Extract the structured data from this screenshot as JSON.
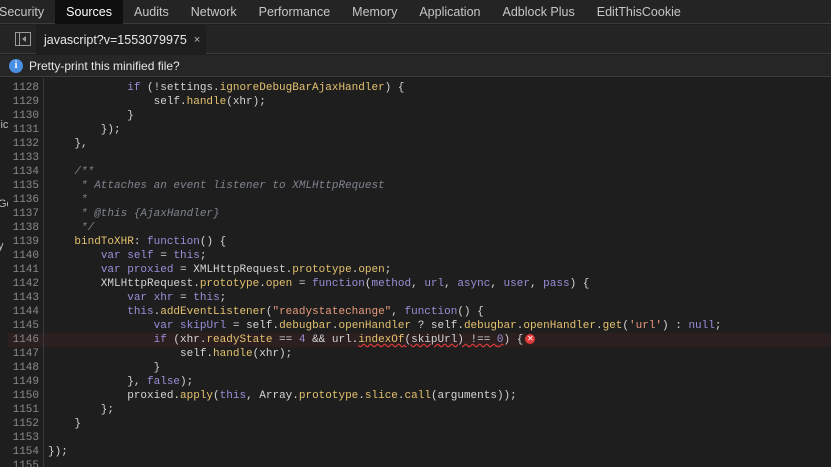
{
  "devtools_tabs": [
    "Security",
    "Sources",
    "Audits",
    "Network",
    "Performance",
    "Memory",
    "Application",
    "Adblock Plus",
    "EditThisCookie"
  ],
  "active_tab": "Sources",
  "file_tab": {
    "name": "javascript?v=1553079975",
    "close": "×"
  },
  "infobar": {
    "message": "Pretty-print this minified file?"
  },
  "left_strip": [
    "lic",
    "Go",
    "y"
  ],
  "error_line": 1146,
  "code_lines": [
    {
      "n": 1128,
      "html": "            <span class='kw'>if</span> (!settings.<span class='fn'>ignoreDebugBarAjaxHandler</span>) {"
    },
    {
      "n": 1129,
      "html": "                self.<span class='fn'>handle</span>(xhr);"
    },
    {
      "n": 1130,
      "html": "            }"
    },
    {
      "n": 1131,
      "html": "        });"
    },
    {
      "n": 1132,
      "html": "    },"
    },
    {
      "n": 1133,
      "html": ""
    },
    {
      "n": 1134,
      "html": "    <span class='cmt'>/**</span>"
    },
    {
      "n": 1135,
      "html": "<span class='cmt'>     * Attaches an event listener to XMLHttpRequest</span>"
    },
    {
      "n": 1136,
      "html": "<span class='cmt'>     *</span>"
    },
    {
      "n": 1137,
      "html": "<span class='cmt'>     * @this {AjaxHandler}</span>"
    },
    {
      "n": 1138,
      "html": "<span class='cmt'>     */</span>"
    },
    {
      "n": 1139,
      "html": "    <span class='fn'>bindToXHR</span>: <span class='kw'>function</span>() {"
    },
    {
      "n": 1140,
      "html": "        <span class='kw'>var</span> <span class='param'>self</span> = <span class='kw'>this</span>;"
    },
    {
      "n": 1141,
      "html": "        <span class='kw'>var</span> <span class='param'>proxied</span> = XMLHttpRequest.<span class='fn'>prototype</span>.<span class='fn'>open</span>;"
    },
    {
      "n": 1142,
      "html": "        XMLHttpRequest.<span class='fn'>prototype</span>.<span class='fn'>open</span> = <span class='kw'>function</span>(<span class='param'>method</span>, <span class='param'>url</span>, <span class='param'>async</span>, <span class='param'>user</span>, <span class='param'>pass</span>) {"
    },
    {
      "n": 1143,
      "html": "            <span class='kw'>var</span> <span class='param'>xhr</span> = <span class='kw'>this</span>;"
    },
    {
      "n": 1144,
      "html": "            <span class='kw'>this</span>.<span class='fn'>addEventListener</span>(<span class='str'>\"readystatechange\"</span>, <span class='kw'>function</span>() {"
    },
    {
      "n": 1145,
      "html": "                <span class='kw'>var</span> <span class='param'>skipUrl</span> = self.<span class='fn'>debugbar</span>.<span class='fn'>openHandler</span> ? self.<span class='fn'>debugbar</span>.<span class='fn'>openHandler</span>.<span class='fn'>get</span>(<span class='str'>'url'</span>) : <span class='kw'>null</span>;"
    },
    {
      "n": 1146,
      "html": "                <span class='kw'>if</span> (xhr.<span class='fn'>readyState</span> == <span class='num'>4</span> &amp;&amp; url.<span class='fn squiggle'>indexOf</span><span class='squiggle'>(skipUrl) !== </span><span class='num squiggle'>0</span>) {<span class='err-icon' data-name='error-icon' data-interactable='true'>✕</span>"
    },
    {
      "n": 1147,
      "html": "                    self.<span class='fn'>handle</span>(xhr);"
    },
    {
      "n": 1148,
      "html": "                }"
    },
    {
      "n": 1149,
      "html": "            }, <span class='kw'>false</span>);"
    },
    {
      "n": 1150,
      "html": "            proxied.<span class='fn'>apply</span>(<span class='kw'>this</span>, Array.<span class='fn'>prototype</span>.<span class='fn'>slice</span>.<span class='fn'>call</span>(arguments));"
    },
    {
      "n": 1151,
      "html": "        };"
    },
    {
      "n": 1152,
      "html": "    }"
    },
    {
      "n": 1153,
      "html": ""
    },
    {
      "n": 1154,
      "html": "});"
    },
    {
      "n": 1155,
      "html": ""
    }
  ]
}
